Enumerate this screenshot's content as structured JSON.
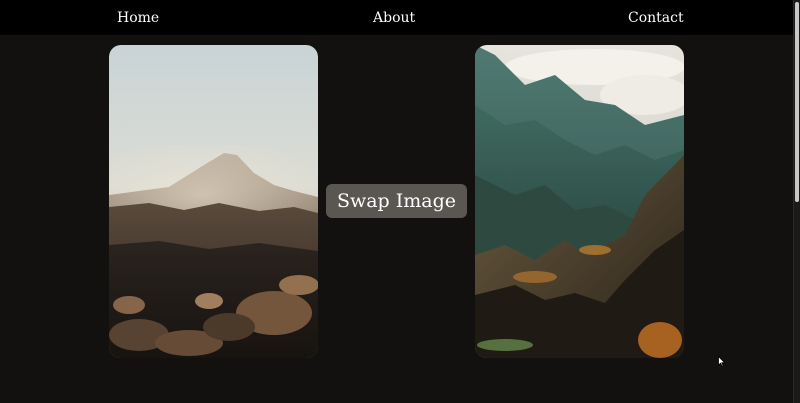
{
  "nav": {
    "home": "Home",
    "about": "About",
    "contact": "Contact"
  },
  "main": {
    "swap_button_label": "Swap Image",
    "left_image": "mountain-peak-photo",
    "right_image": "green-valley-photo"
  },
  "colors": {
    "navbar": "#000000",
    "background": "#121110",
    "button": "#5a5752",
    "text": "#ffffff"
  }
}
